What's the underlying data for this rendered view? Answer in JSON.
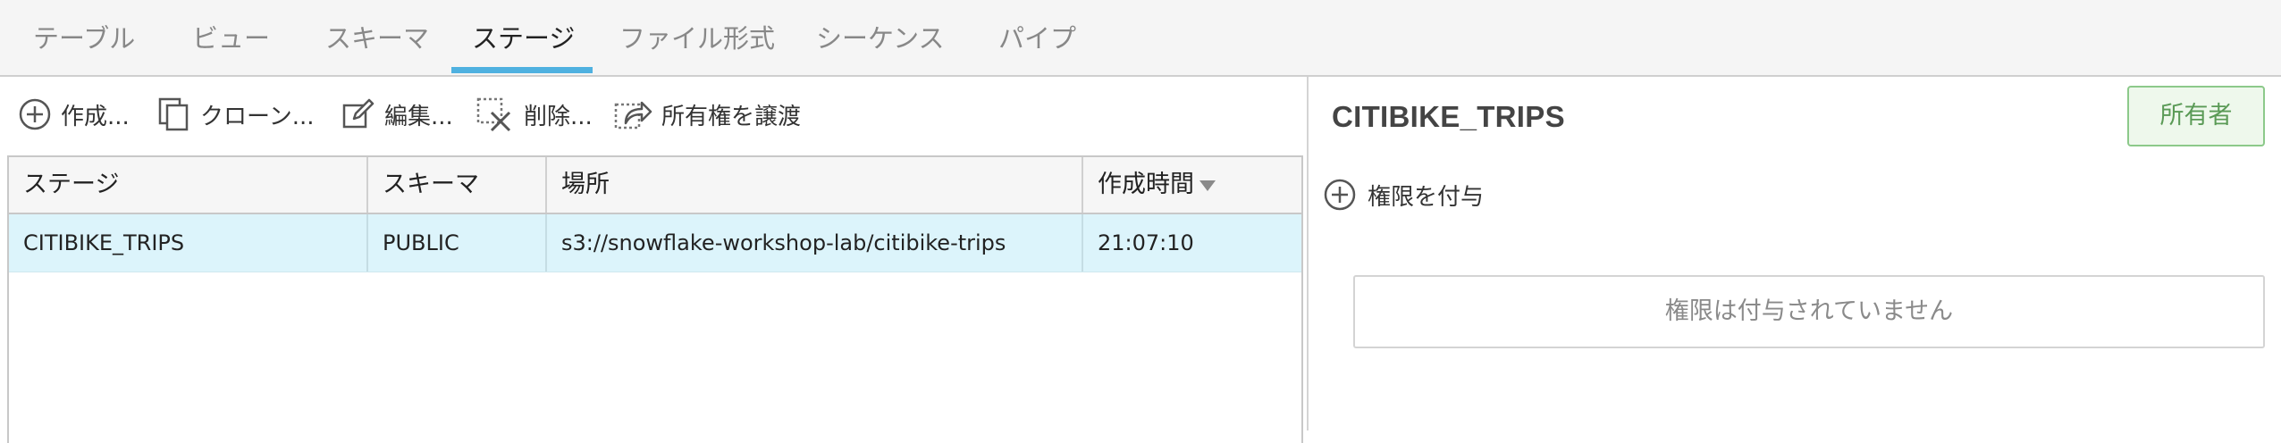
{
  "tabs": [
    {
      "label": "テーブル",
      "active": false
    },
    {
      "label": "ビュー",
      "active": false
    },
    {
      "label": "スキーマ",
      "active": false
    },
    {
      "label": "ステージ",
      "active": true
    },
    {
      "label": "ファイル形式",
      "active": false
    },
    {
      "label": "シーケンス",
      "active": false
    },
    {
      "label": "パイプ",
      "active": false
    }
  ],
  "toolbar": {
    "create_label": "作成...",
    "clone_label": "クローン...",
    "edit_label": "編集...",
    "delete_label": "削除...",
    "transfer_label": "所有権を譲渡"
  },
  "grid": {
    "columns": [
      "ステージ",
      "スキーマ",
      "場所",
      "作成時間"
    ],
    "sort_column": "作成時間",
    "rows": [
      {
        "stage": "CITIBIKE_TRIPS",
        "schema": "PUBLIC",
        "location": "s3://snowflake-workshop-lab/citibike-trips",
        "created": "21:07:10"
      }
    ]
  },
  "detail": {
    "title": "CITIBIKE_TRIPS",
    "owner_button": "所有者",
    "grant_label": "権限を付与",
    "empty_message": "権限は付与されていません"
  },
  "colors": {
    "accent": "#4fb1e0",
    "selected_row": "#dcf4fb",
    "owner_border": "#8cc98a",
    "owner_text": "#5a9a56"
  }
}
